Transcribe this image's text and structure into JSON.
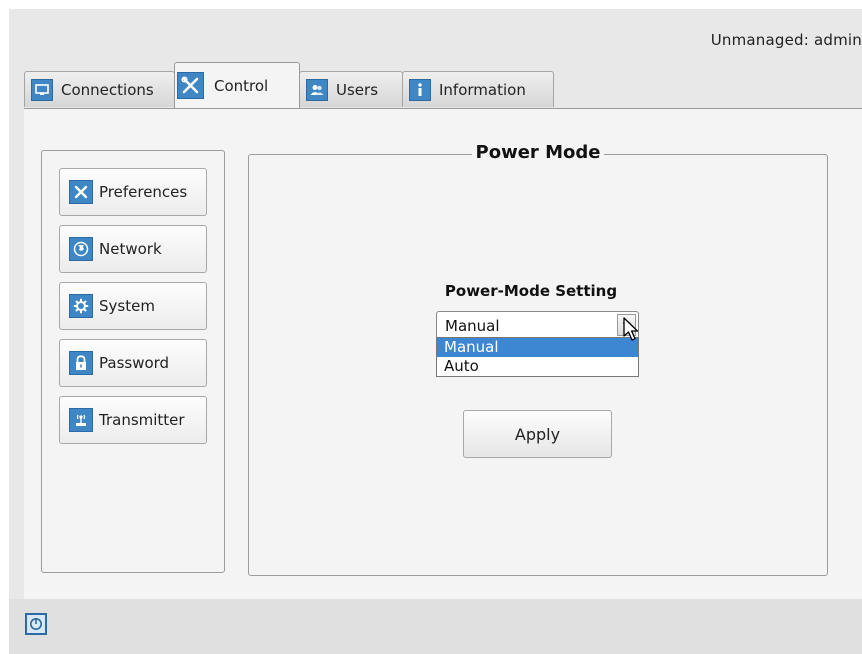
{
  "header": {
    "user_status": "Unmanaged: admin"
  },
  "tabs": [
    {
      "label": "Connections",
      "icon": "monitor-icon",
      "active": false
    },
    {
      "label": "Control",
      "icon": "tools-icon",
      "active": true
    },
    {
      "label": "Users",
      "icon": "users-icon",
      "active": false
    },
    {
      "label": "Information",
      "icon": "info-icon",
      "active": false
    }
  ],
  "sidebar": {
    "items": [
      {
        "label": "Preferences",
        "icon": "tools-icon"
      },
      {
        "label": "Network",
        "icon": "globe-icon"
      },
      {
        "label": "System",
        "icon": "gear-icon"
      },
      {
        "label": "Password",
        "icon": "lock-icon"
      },
      {
        "label": "Transmitter",
        "icon": "antenna-icon"
      }
    ]
  },
  "main": {
    "group_title": "Power Mode",
    "setting_label": "Power-Mode Setting",
    "select": {
      "value": "Manual",
      "options": [
        "Manual",
        "Auto"
      ],
      "highlighted": "Manual"
    },
    "apply_label": "Apply"
  },
  "footer": {
    "icon": "power-icon"
  },
  "colors": {
    "accent": "#3e86c4",
    "selection": "#3c86d2",
    "background": "#e8e8e8",
    "panel": "#f4f4f4"
  }
}
